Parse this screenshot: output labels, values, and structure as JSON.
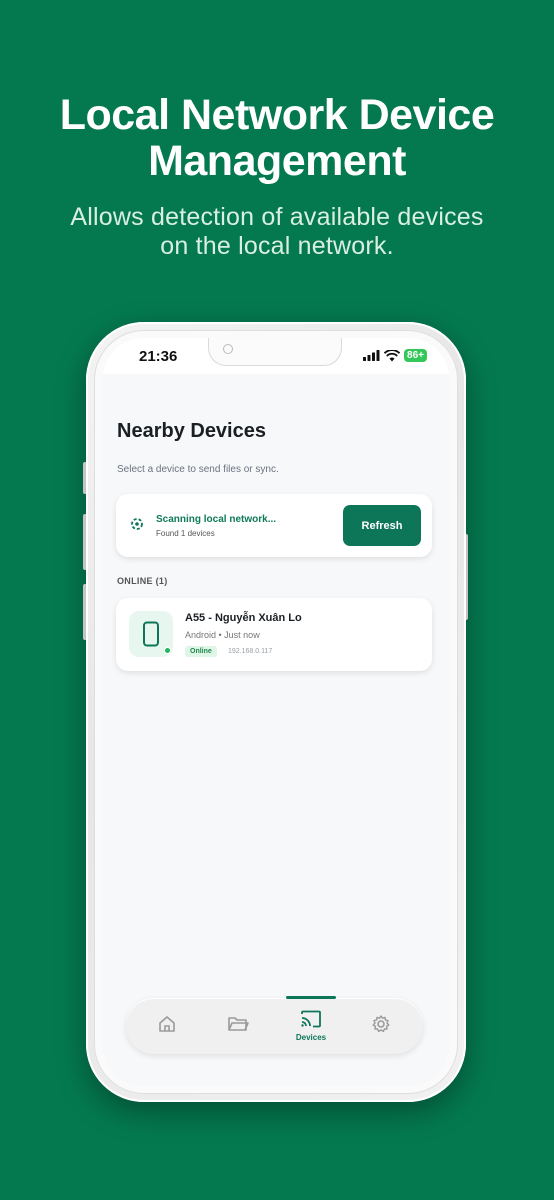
{
  "hero": {
    "title_line1": "Local Network Device",
    "title_line2": "Management",
    "subtitle_line1": "Allows detection of available devices",
    "subtitle_line2": "on the local network."
  },
  "status_bar": {
    "time": "21:36",
    "battery": "86+"
  },
  "screen": {
    "title": "Nearby Devices",
    "subtitle": "Select a device to send files or sync."
  },
  "scan": {
    "status": "Scanning local network...",
    "count": "Found 1 devices",
    "refresh_label": "Refresh"
  },
  "section": {
    "online_label": "ONLINE (1)"
  },
  "devices": [
    {
      "name": "A55 - Nguyễn Xuân Lo",
      "meta": "Android • Just now",
      "status": "Online",
      "ip": "192.168.0.117"
    }
  ],
  "nav": {
    "items": [
      {
        "icon": "home-icon",
        "label": ""
      },
      {
        "icon": "folder-icon",
        "label": ""
      },
      {
        "icon": "cast-icon",
        "label": "Devices",
        "active": true
      },
      {
        "icon": "gear-icon",
        "label": ""
      }
    ]
  },
  "colors": {
    "background": "#047950",
    "accent": "#0d7659",
    "online": "#22b45e"
  }
}
